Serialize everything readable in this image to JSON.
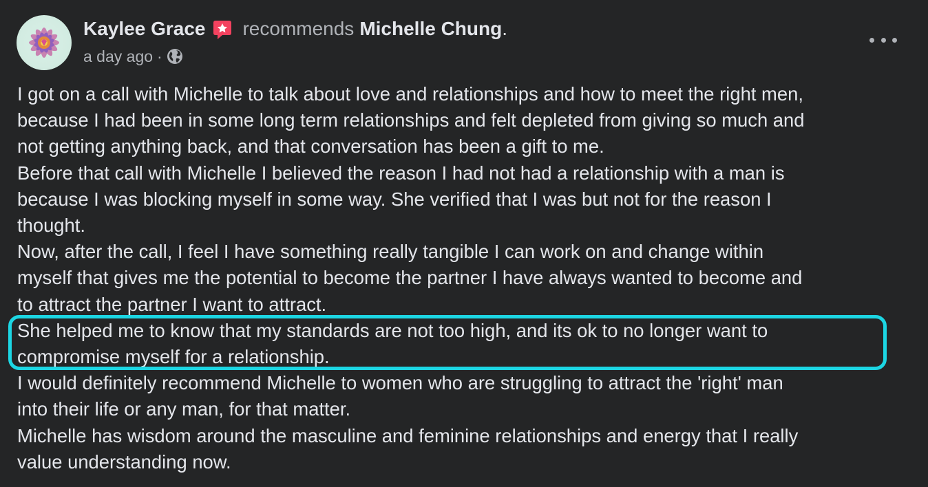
{
  "post": {
    "author": "Kaylee Grace",
    "action": "recommends",
    "recommended": "Michelle Chung",
    "period": ".",
    "timestamp": "a day ago",
    "separator": "·",
    "privacy_icon": "globe-icon",
    "more_icon": "more-options-icon",
    "badge_icon": "recommendation-star-icon",
    "highlight_color": "#1cd6e3",
    "lines": [
      "I got on a call with Michelle to talk about love and relationships and how to meet the right men,",
      "because I had been in some long term relationships and felt depleted from giving so much and",
      "not getting anything back, and that conversation has been a gift to me.",
      "Before that call with Michelle I believed the reason I had not had a relationship with a man is",
      "because I was blocking myself in some way. She verified that I was but not for the reason I",
      "thought.",
      "Now, after the call, I feel I have something really tangible I can work on and change within",
      "myself that gives me the potential to become the partner I have always wanted to become and",
      "to attract the partner I want to attract.",
      "She helped me to know that my standards are not too high, and its ok to no longer want to",
      "compromise myself for a relationship.",
      "I would definitely recommend Michelle to women who are struggling to attract the 'right' man",
      "into their life or any man, for that matter.",
      "Michelle has wisdom around the masculine and feminine relationships and energy that I really",
      "value understanding now."
    ]
  }
}
